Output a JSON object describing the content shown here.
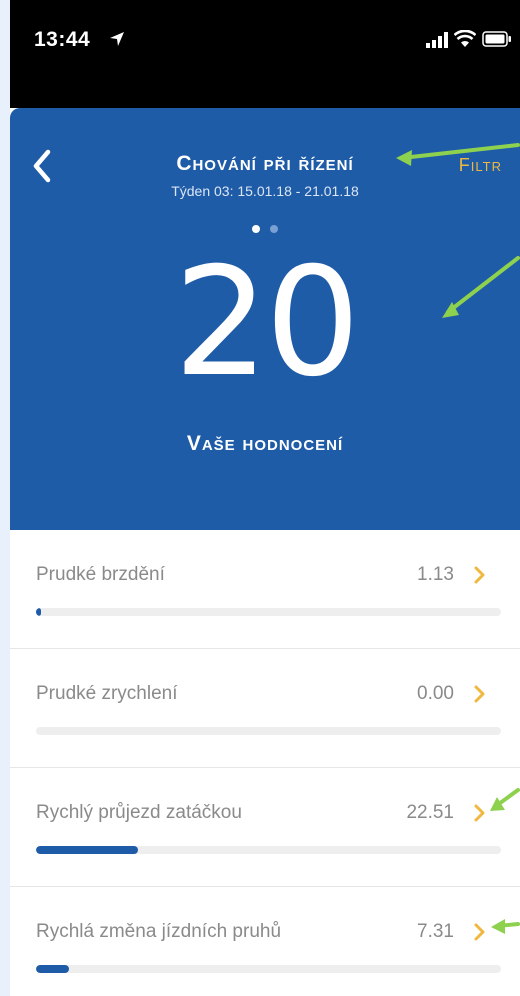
{
  "status_bar": {
    "time": "13:44",
    "icons": [
      "location-arrow-icon",
      "signal-icon",
      "wifi-icon",
      "battery-icon"
    ]
  },
  "header": {
    "title": "Chování při řízení",
    "subtitle": "Týden 03: 15.01.18 - 21.01.18",
    "filter_label": "Filtr",
    "page_dots": {
      "count": 2,
      "active_index": 0
    },
    "score": "20",
    "score_label": "Vaše hodnocení",
    "background_color": "#1f5ca8",
    "accent_color": "#f0b840"
  },
  "metrics": [
    {
      "label": "Prudké brzdění",
      "value": "1.13",
      "fill": 0.01
    },
    {
      "label": "Prudké zrychlení",
      "value": "0.00",
      "fill": 0.0
    },
    {
      "label": "Rychlý průjezd zatáčkou",
      "value": "22.51",
      "fill": 0.22
    },
    {
      "label": "Rychlá změna jízdních pruhů",
      "value": "7.31",
      "fill": 0.07
    }
  ],
  "annotation_color": "#8ed14f"
}
